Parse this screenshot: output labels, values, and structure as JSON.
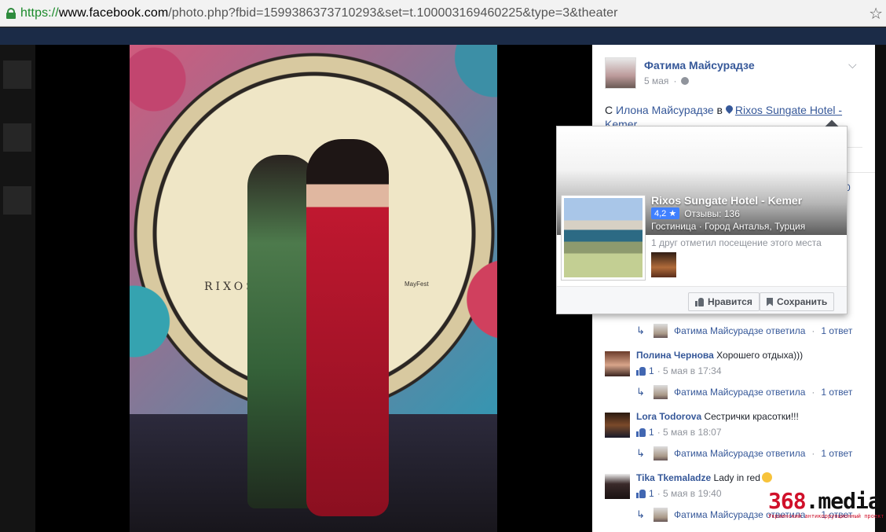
{
  "browser": {
    "url_scheme": "https://",
    "url_host": "www.facebook.com",
    "url_path": "/photo.php?fbid=1599386373710293&set=t.100003169460225&type=3&theater"
  },
  "photo": {
    "logo_text": "RIXOS",
    "event_text": "MayFest"
  },
  "post": {
    "author": "Фатима Майсурадзе",
    "date": "5 мая",
    "with_prefix": "С",
    "with_person": "Илона Майсурадзе",
    "in_word": "в",
    "place": "Rixos Sungate Hotel - Kemer",
    "partial_count": "0"
  },
  "hovercard": {
    "name": "Rixos Sungate Hotel - Kemer",
    "rating": "4,2 ★",
    "reviews": "Отзывы: 136",
    "category": "Гостиница · Город Анталья, Турция",
    "friends_text": "1 друг отметил посещение этого места",
    "like_label": "Нравится",
    "save_label": "Сохранить"
  },
  "replies": [
    {
      "name": "Фатима Майсурадзе ответила",
      "sep": "·",
      "count": "1 ответ"
    },
    {
      "name": "Фатима Майсурадзе ответила",
      "sep": "·",
      "count": "1 ответ"
    },
    {
      "name": "Фатима Майсурадзе ответила",
      "sep": "·",
      "count": "1 ответ"
    },
    {
      "name": "Фатима Майсурадзе ответила",
      "sep": "·",
      "count": "1 ответ"
    }
  ],
  "comments": [
    {
      "name": "Полина Чернова",
      "text": "Хорошего отдыха)))",
      "likes": "1",
      "time": "· 5 мая в 17:34"
    },
    {
      "name": "Lora Todorova",
      "text": "Сестрички красотки!!!",
      "likes": "1",
      "time": "· 5 мая в 18:07"
    },
    {
      "name": "Tika Tkemaladze",
      "text": "Lady in red",
      "likes": "1",
      "time": "· 5 мая в 19:40"
    }
  ],
  "watermark": {
    "number": "368",
    "domain": ".media",
    "tagline": "Украинский антикоррупционный проект"
  },
  "colors": {
    "fb_link": "#365899",
    "rating_badge": "#4080ff",
    "watermark_red": "#d0102a"
  }
}
